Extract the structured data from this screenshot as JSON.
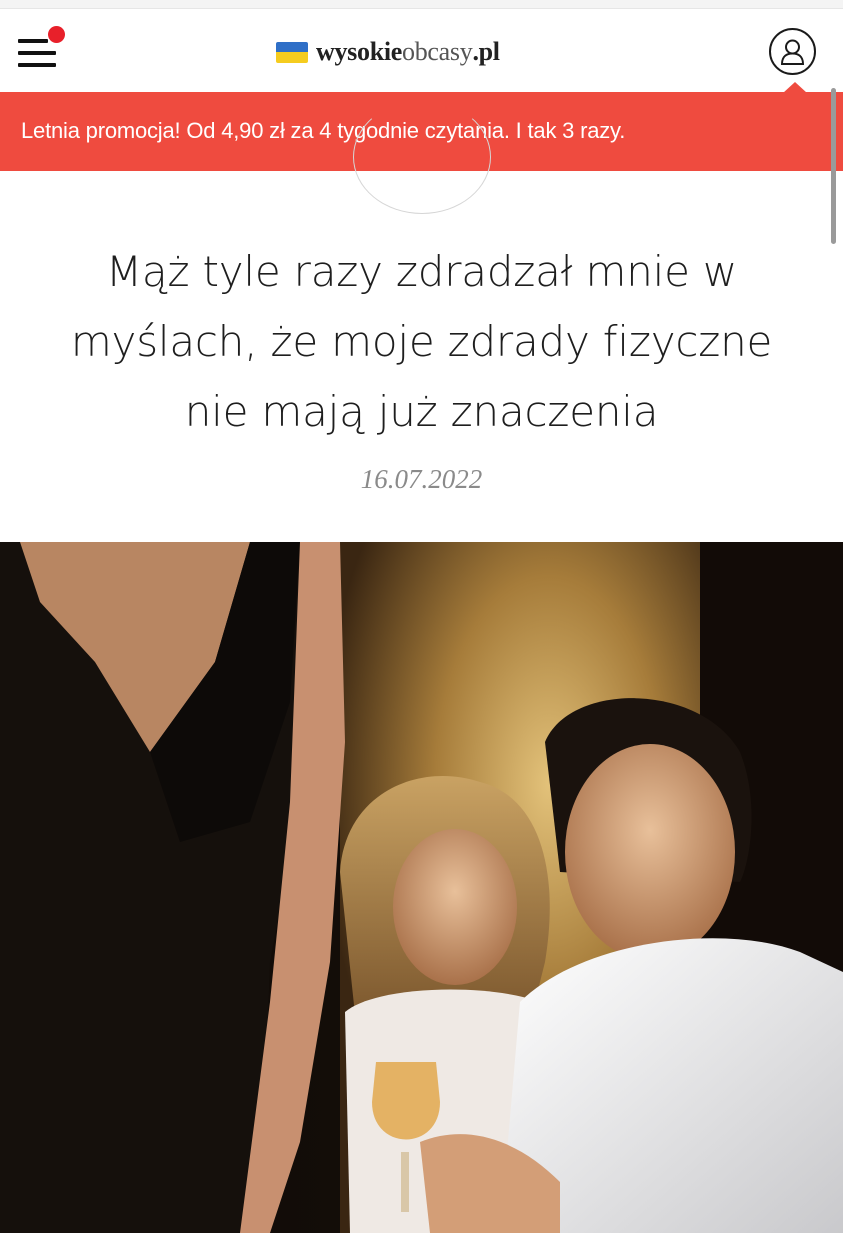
{
  "header": {
    "menu_icon": "hamburger-menu-icon",
    "notification_color": "#e8202a",
    "logo": {
      "part1": "wysokie",
      "part2": "obcasy",
      "part3": ".pl",
      "flag_icon": "ukraine-flag-icon"
    },
    "user_icon": "user-account-icon"
  },
  "promo": {
    "text": "Letnia promocja! Od 4,90 zł za 4 tygodnie czytania. I tak 3 razy.",
    "background": "#ef4b3f"
  },
  "article": {
    "title_lines": [
      "Mąż tyle razy zdradzał mnie w",
      "myślach, że moje zdrady fizyczne",
      "nie mają już znaczenia"
    ],
    "date": "16.07.2022",
    "image_icon": "article-photo"
  }
}
